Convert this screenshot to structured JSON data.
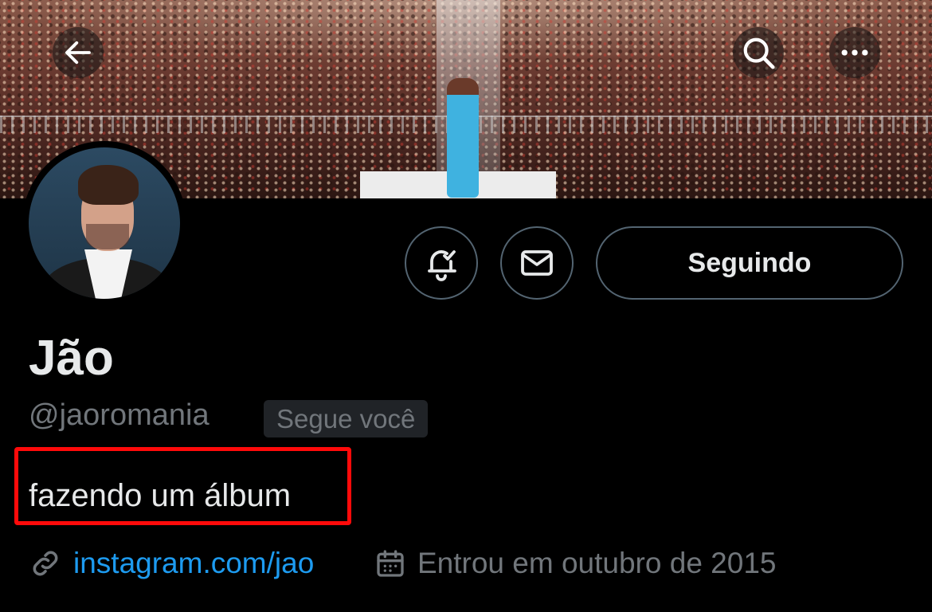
{
  "header": {
    "back_icon": "arrow-left-icon",
    "search_icon": "search-icon",
    "more_icon": "more-horizontal-icon"
  },
  "profile": {
    "display_name": "Jão",
    "handle": "@jaoromania",
    "follows_you_badge": "Segue você",
    "bio": "fazendo um álbum",
    "link": "instagram.com/jao",
    "joined": "Entrou em outubro de 2015"
  },
  "actions": {
    "notifications_icon": "bell-check-icon",
    "message_icon": "mail-icon",
    "follow_label": "Seguindo"
  },
  "colors": {
    "background": "#000000",
    "text": "#e7e9ea",
    "secondary_text": "#71767b",
    "link": "#1d9bf0",
    "highlight_border": "#ff0a0a"
  }
}
